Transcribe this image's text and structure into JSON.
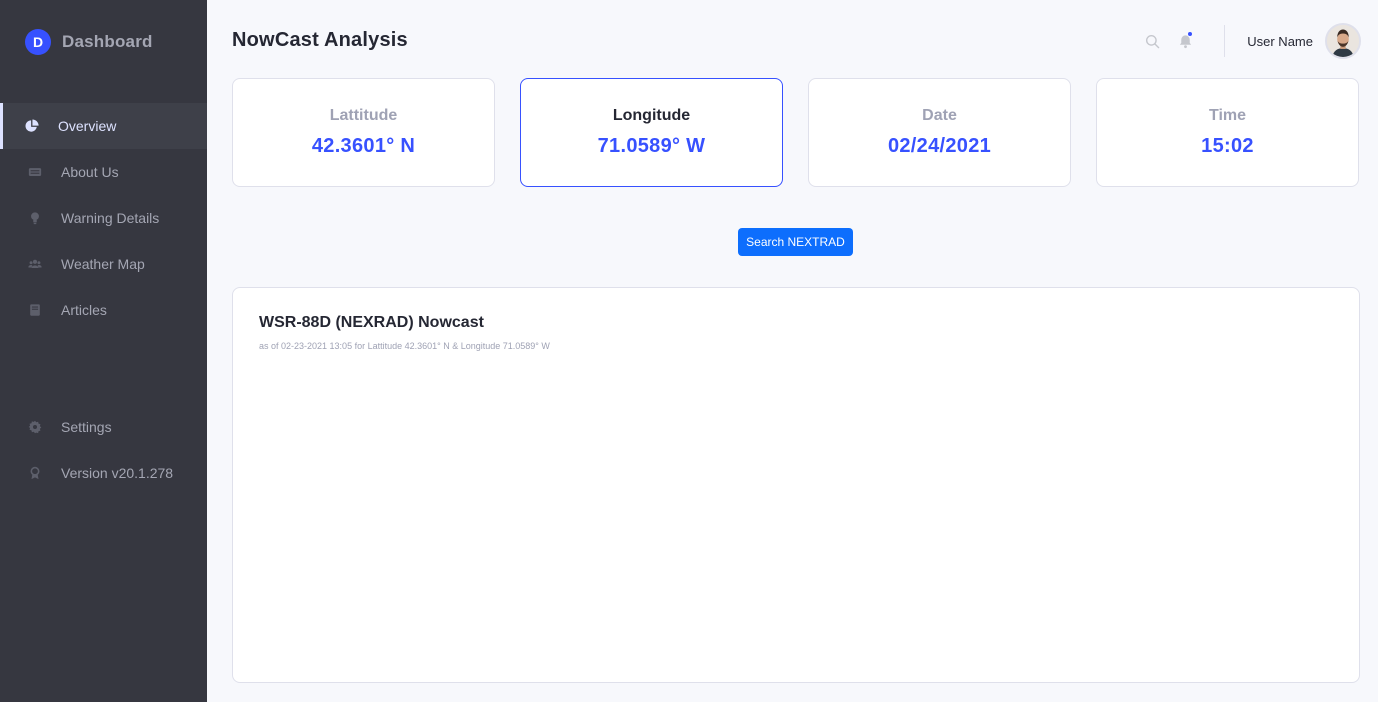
{
  "brand": {
    "logo_letter": "D",
    "title": "Dashboard"
  },
  "sidebar": {
    "items": [
      {
        "label": "Overview",
        "icon": "pie-chart-icon",
        "active": true
      },
      {
        "label": "About Us",
        "icon": "ticket-icon"
      },
      {
        "label": "Warning Details",
        "icon": "lightbulb-icon"
      },
      {
        "label": "Weather Map",
        "icon": "users-icon"
      },
      {
        "label": "Articles",
        "icon": "book-icon"
      }
    ],
    "bottom_items": [
      {
        "label": "Settings",
        "icon": "gear-icon"
      },
      {
        "label": "Version v20.1.278",
        "icon": "award-icon"
      }
    ]
  },
  "header": {
    "title": "NowCast Analysis",
    "user_name": "User Name"
  },
  "cards": [
    {
      "label": "Lattitude",
      "value": "42.3601° N"
    },
    {
      "label": "Longitude",
      "value": "71.0589° W",
      "active": true
    },
    {
      "label": "Date",
      "value": "02/24/2021"
    },
    {
      "label": "Time",
      "value": "15:02"
    }
  ],
  "search_button": {
    "label": "Search NEXTRAD"
  },
  "panel": {
    "title": "WSR-88D (NEXRAD) Nowcast",
    "subtitle": "as of 02-23-2021 13:05 for Lattitude 42.3601° N & Longitude 71.0589° W"
  },
  "colors": {
    "accent": "#3751ff",
    "sidebar_bg": "#363740",
    "button_bg": "#0d6efd"
  }
}
